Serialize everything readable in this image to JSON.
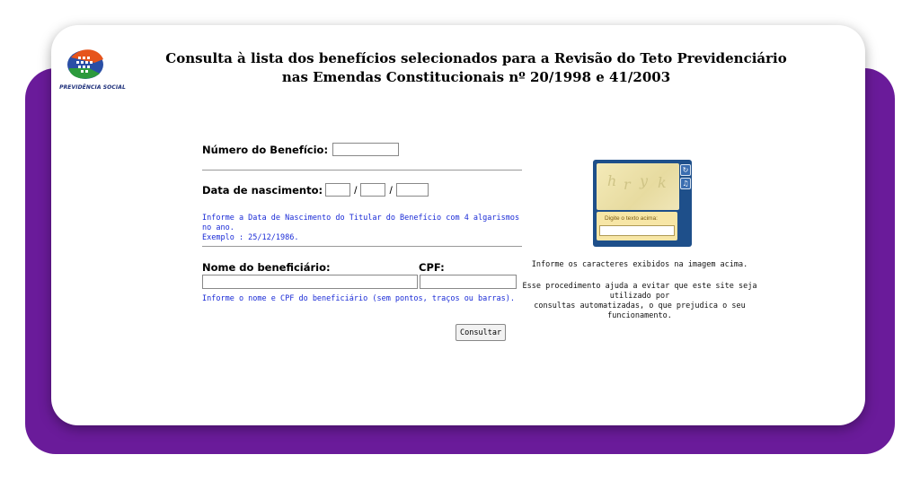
{
  "header": {
    "logo_text": "PREVIDÊNCIA SOCIAL",
    "title": "Consulta à lista dos benefícios selecionados para a Revisão do Teto Previdenciário nas Emendas Constitucionais nº 20/1998 e 41/2003"
  },
  "form": {
    "beneficio_label": "Número do Benefício:",
    "beneficio_value": "",
    "nascimento_label": "Data de nascimento:",
    "date_separator": "/",
    "nascimento_hint": "Informe a Data de Nascimento do Titular do Benefício com 4 algarismos no ano.",
    "nascimento_example": "Exemplo : 25/12/1986.",
    "nome_label": "Nome do beneficiário:",
    "cpf_label": "CPF:",
    "nome_cpf_hint": "Informe o nome e CPF do beneficiário (sem pontos, traços ou barras).",
    "submit_label": "Consultar"
  },
  "captcha": {
    "input_label": "Digite o texto acima:",
    "instruction": "Informe os caracteres exibidos na imagem acima.",
    "explanation_line1": "Esse procedimento ajuda a evitar que este site seja utilizado por",
    "explanation_line2": "consultas automatizadas, o que prejudica o seu funcionamento."
  },
  "colors": {
    "frame_purple": "#6a1b9a",
    "hint_blue": "#1a2bd6",
    "captcha_blue": "#1e4f8a"
  },
  "icons": [
    "previdencia-logo-icon",
    "refresh-icon",
    "audio-icon"
  ]
}
